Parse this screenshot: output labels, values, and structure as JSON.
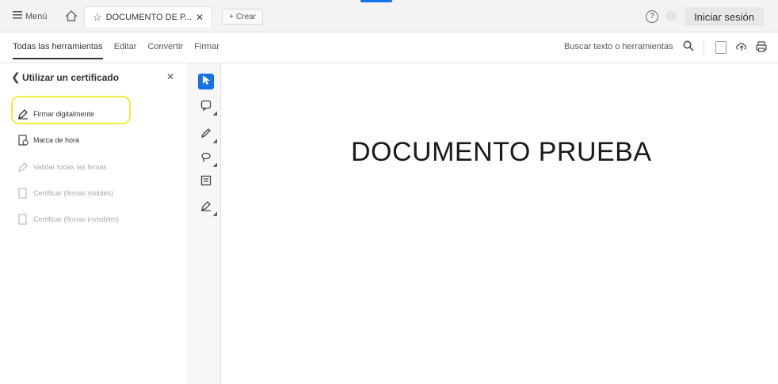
{
  "tabbar": {
    "menu_label": "Menú",
    "doc_tab_title": "DOCUMENTO DE P...",
    "new_tab_label": "Crear",
    "login_label": "Iniciar sesión"
  },
  "toolbar": {
    "tabs": [
      "Todas las herramientas",
      "Editar",
      "Convertir",
      "Firmar"
    ],
    "search_label": "Buscar texto o herramientas"
  },
  "panel": {
    "title": "Utilizar un certificado",
    "items": [
      {
        "label": "Firmar digitalmente",
        "enabled": true,
        "icon": "pen-sign-icon"
      },
      {
        "label": "Marca de hora",
        "enabled": true,
        "icon": "timestamp-icon"
      },
      {
        "label": "Validar todas las firmas",
        "enabled": false,
        "icon": "validate-icon"
      },
      {
        "label": "Certificar (firmas visibles)",
        "enabled": false,
        "icon": "certify-visible-icon"
      },
      {
        "label": "Certificar (firmas invisibles)",
        "enabled": false,
        "icon": "certify-invisible-icon"
      }
    ]
  },
  "strip": {
    "tools": [
      "select-icon",
      "comment-icon",
      "draw-icon",
      "lasso-icon",
      "text-select-icon",
      "sign-icon"
    ]
  },
  "document": {
    "title": "DOCUMENTO PRUEBA"
  },
  "colors": {
    "accent": "#1473e6",
    "highlight": "#f0ec3c"
  }
}
